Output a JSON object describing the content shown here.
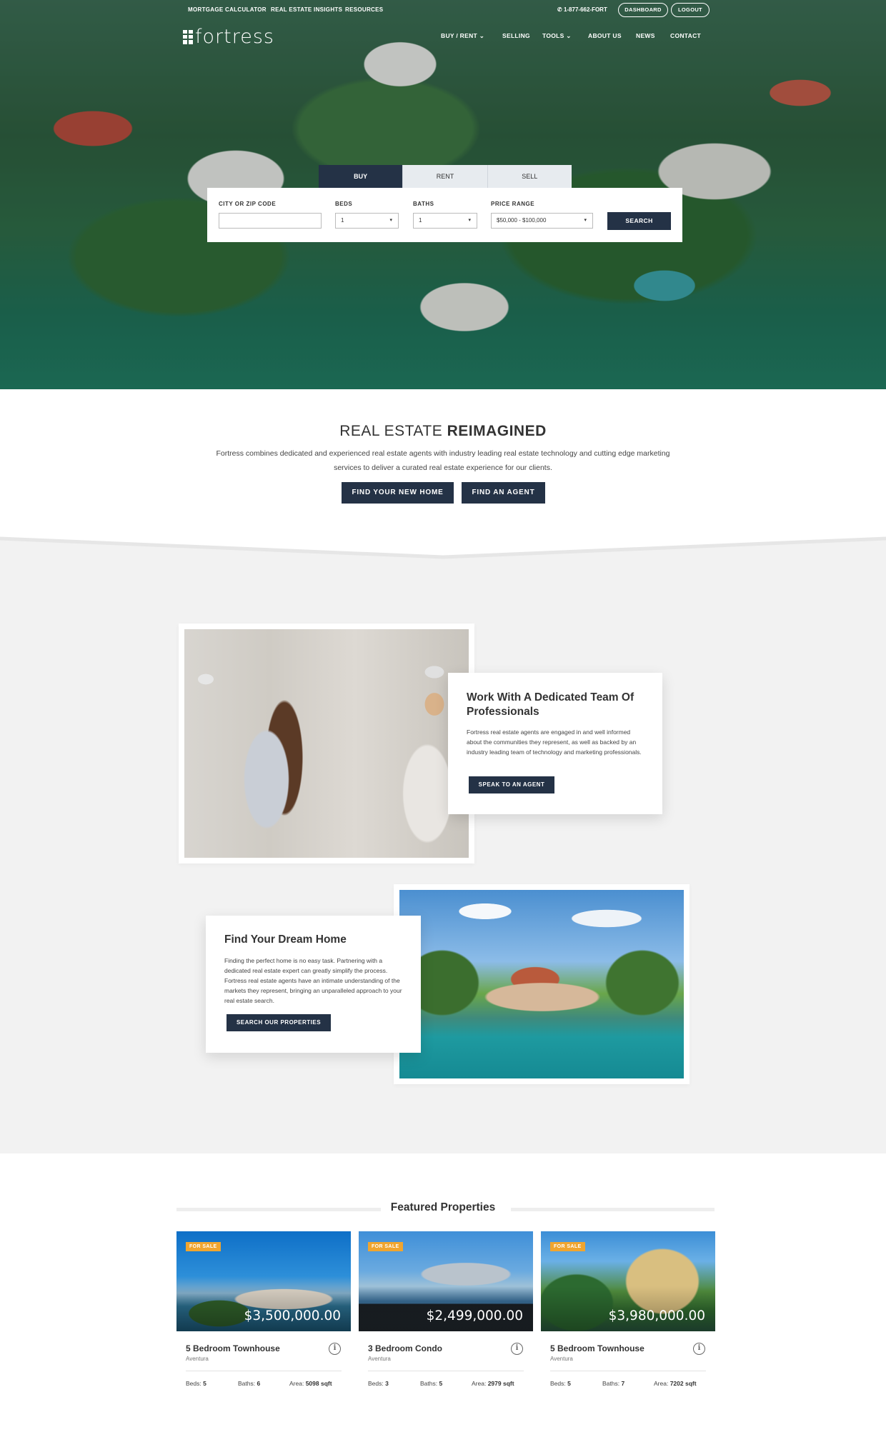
{
  "topbar": {
    "links": [
      "MORTGAGE CALCULATOR",
      "REAL ESTATE INSIGHTS",
      "RESOURCES"
    ],
    "phone": "1-877-662-FORT",
    "dashboard": "DASHBOARD",
    "logout": "LOGOUT"
  },
  "brand": {
    "name": "fortress"
  },
  "nav": {
    "items": [
      "BUY / RENT",
      "SELLING",
      "TOOLS",
      "ABOUT US",
      "NEWS",
      "CONTACT"
    ]
  },
  "search": {
    "tabs": [
      "BUY",
      "RENT",
      "SELL"
    ],
    "active_tab": "BUY",
    "city_label": "CITY OR ZIP CODE",
    "city_value": "",
    "beds_label": "BEDS",
    "beds_value": "1",
    "baths_label": "BATHS",
    "baths_value": "1",
    "price_label": "PRICE RANGE",
    "price_value": "$50,000 - $100,000",
    "button": "SEARCH"
  },
  "intro": {
    "title_light": "REAL ESTATE",
    "title_bold": "REIMAGINED",
    "text": "Fortress combines dedicated and experienced real estate agents with industry leading real estate technology and cutting edge marketing services to deliver a curated real estate experience for our clients.",
    "btn_home": "FIND YOUR NEW HOME",
    "btn_agent": "FIND AN AGENT"
  },
  "team": {
    "title": "Work With A Dedicated Team Of Professionals",
    "text": "Fortress real estate agents are engaged in and well informed about the communities they represent, as well as backed by an industry leading team of technology and marketing professionals.",
    "button": "SPEAK TO AN AGENT"
  },
  "dream": {
    "title": "Find Your Dream Home",
    "text": "Finding the perfect home is no easy task. Partnering with a dedicated real estate expert can greatly simplify the process. Fortress real estate agents have an intimate understanding of the markets they represent, bringing an unparalleled approach to your real estate search.",
    "button": "SEARCH OUR PROPERTIES"
  },
  "featured": {
    "title": "Featured Properties",
    "properties": [
      {
        "badge": "FOR SALE",
        "price": "$3,500,000.00",
        "title": "5 Bedroom Townhouse",
        "city": "Aventura",
        "beds_label": "Beds:",
        "beds": "5",
        "baths_label": "Baths:",
        "baths": "6",
        "area_label": "Area:",
        "area": "5098 sqft"
      },
      {
        "badge": "FOR SALE",
        "price": "$2,499,000.00",
        "title": "3 Bedroom Condo",
        "city": "Aventura",
        "beds_label": "Beds:",
        "beds": "3",
        "baths_label": "Baths:",
        "baths": "5",
        "area_label": "Area:",
        "area": "2979 sqft"
      },
      {
        "badge": "FOR SALE",
        "price": "$3,980,000.00",
        "title": "5 Bedroom Townhouse",
        "city": "Aventura",
        "beds_label": "Beds:",
        "beds": "5",
        "baths_label": "Baths:",
        "baths": "7",
        "area_label": "Area:",
        "area": "7202 sqft"
      }
    ]
  },
  "colors": {
    "navy": "#243246",
    "badge": "#f0a52f",
    "section_gray": "#f2f2f2"
  },
  "icons": {
    "phone": "phone-icon",
    "dropdown": "chevron-down-icon",
    "info": "info-icon"
  }
}
